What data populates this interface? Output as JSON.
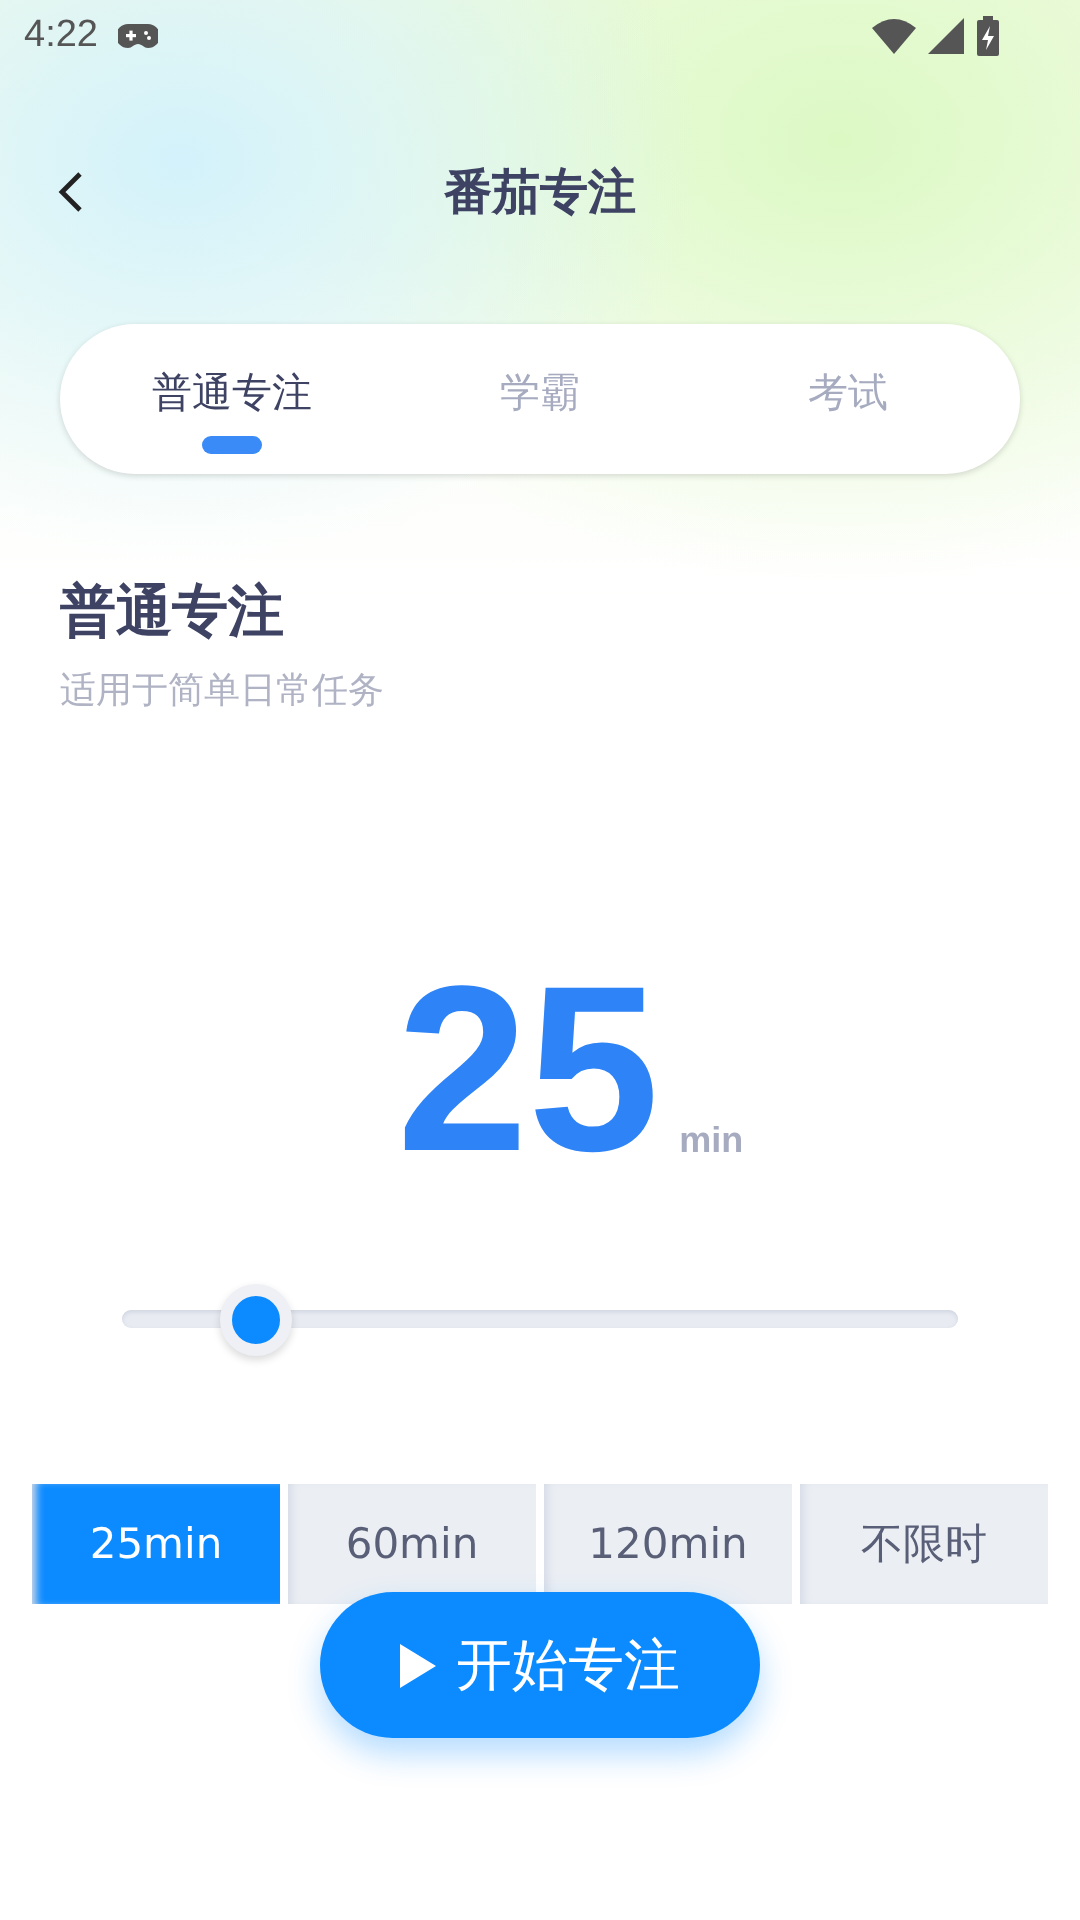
{
  "status_bar": {
    "time": "4:22"
  },
  "header": {
    "title": "番茄专注"
  },
  "tabs": [
    {
      "label": "普通专注",
      "selected": true
    },
    {
      "label": "学霸",
      "selected": false
    },
    {
      "label": "考试",
      "selected": false
    }
  ],
  "mode": {
    "title": "普通专注",
    "subtitle": "适用于简单日常任务"
  },
  "timer": {
    "value": "25",
    "unit": "min"
  },
  "slider": {
    "level": 0.16
  },
  "durations": [
    {
      "label": "25min",
      "selected": true
    },
    {
      "label": "60min",
      "selected": false
    },
    {
      "label": "120min",
      "selected": false
    },
    {
      "label": "不限时",
      "selected": false
    }
  ],
  "start_button": {
    "label": "开始专注"
  }
}
